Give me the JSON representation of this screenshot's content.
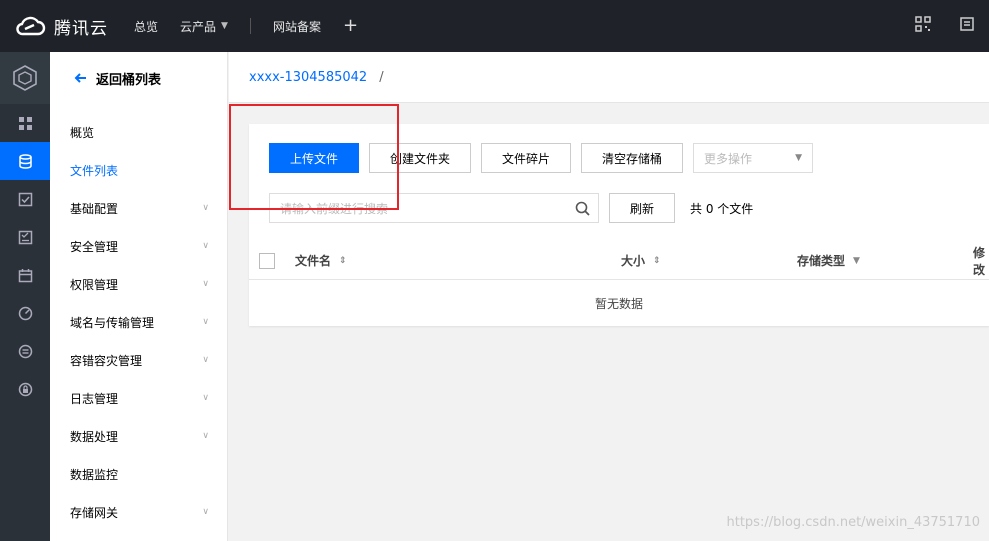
{
  "topbar": {
    "brand": "腾讯云",
    "nav": [
      {
        "label": "总览"
      },
      {
        "label": "云产品"
      },
      {
        "label": "网站备案"
      }
    ],
    "plus": "+"
  },
  "sidebar": {
    "back_label": "返回桶列表",
    "items": [
      {
        "label": "概览"
      },
      {
        "label": "文件列表"
      },
      {
        "label": "基础配置"
      },
      {
        "label": "安全管理"
      },
      {
        "label": "权限管理"
      },
      {
        "label": "域名与传输管理"
      },
      {
        "label": "容错容灾管理"
      },
      {
        "label": "日志管理"
      },
      {
        "label": "数据处理"
      },
      {
        "label": "数据监控"
      },
      {
        "label": "存储网关"
      }
    ]
  },
  "breadcrumb": {
    "bucket": "xxxx-1304585042",
    "separator": "/"
  },
  "toolbar": {
    "upload": "上传文件",
    "create_folder": "创建文件夹",
    "fragments": "文件碎片",
    "clear_bucket": "清空存储桶",
    "more_ops": "更多操作"
  },
  "search": {
    "placeholder": "请输入前缀进行搜索",
    "refresh": "刷新",
    "count": "共 0 个文件"
  },
  "table": {
    "columns": [
      "文件名",
      "大小",
      "存储类型",
      "修改"
    ],
    "empty": "暂无数据"
  },
  "watermark": "https://blog.csdn.net/weixin_43751710",
  "colors": {
    "accent": "#006eff",
    "topbar": "#1f2329",
    "highlight": "#e3262b"
  }
}
